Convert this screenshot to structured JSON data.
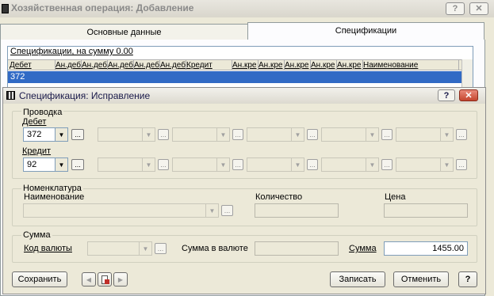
{
  "parent": {
    "title": "Хозяйственная операция: Добавление",
    "help_button": "?",
    "close_button": "✕",
    "tabs": [
      {
        "label": "Основные данные"
      },
      {
        "label": "Спецификации"
      }
    ],
    "spec_sum_label": "Спецификации, на сумму 0.00",
    "table_headers": [
      "Дебет",
      "Ан.деб",
      "Ан.деб",
      "Ан.деб",
      "Ан.деб",
      "Ан.деб",
      "Кредит",
      "Ан.кре",
      "Ан.кре",
      "Ан.кре",
      "Ан.кре",
      "Ан.кре",
      "Наименование"
    ],
    "selected_row": {
      "debet": "372"
    }
  },
  "dialog": {
    "title": "Спецификация: Исправление",
    "help_button": "?",
    "close_button": "✕",
    "provodka": {
      "group_label": "Проводка",
      "debet_label": "Дебет",
      "debet_value": "372",
      "kredit_label": "Кредит",
      "kredit_value": "92"
    },
    "nomenklatura": {
      "group_label": "Номенклатура",
      "name_label": "Наименование",
      "qty_label": "Количество",
      "price_label": "Цена"
    },
    "summa_group": {
      "group_label": "Сумма",
      "currency_code_label": "Код валюты",
      "sum_currency_label": "Сумма в валюте",
      "sum_label": "Сумма",
      "sum_value": "1455.00"
    },
    "buttons": {
      "save": "Сохранить",
      "record": "Записать",
      "cancel": "Отменить",
      "help": "?"
    },
    "icons": {
      "nav_prev": "◀",
      "nav_next": "▶",
      "dropdown": "▼",
      "dots": "..."
    }
  }
}
